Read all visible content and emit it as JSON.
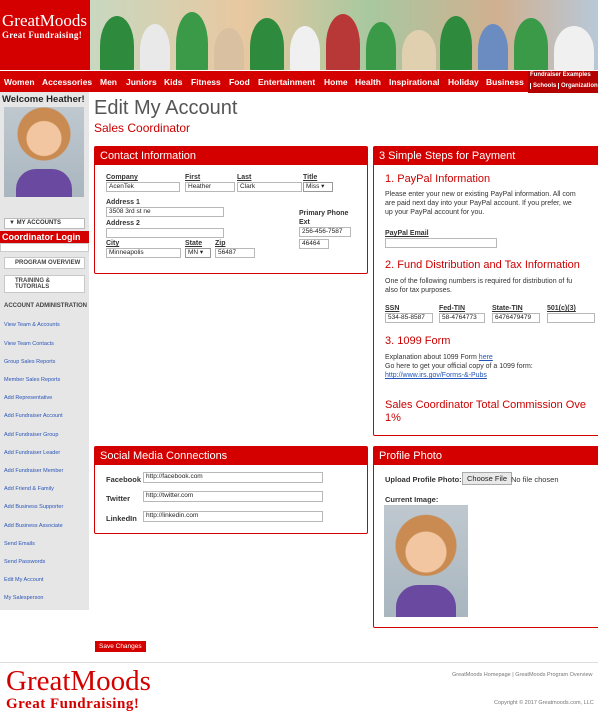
{
  "header": {
    "logo_line1": "GreatMoods",
    "logo_line2": "Great Fundraising!"
  },
  "nav": {
    "items": [
      "Women",
      "Accessories",
      "Men",
      "Juniors",
      "Kids",
      "Fitness",
      "Food",
      "Entertainment",
      "Home",
      "Health",
      "Inspirational",
      "Holiday",
      "Business"
    ],
    "fundraiser_examples": "Fundraiser Examples",
    "sub_items": [
      "Schools",
      "Organization"
    ]
  },
  "sidebar": {
    "welcome": "Welcome Heather!",
    "my_accounts": "▼ MY ACCOUNTS",
    "coordinator_login": "Coordinator Login",
    "program_overview": "PROGRAM OVERVIEW",
    "training": "TRAINING & TUTORIALS",
    "account_admin": "ACCOUNT ADMINISTRATION",
    "links": [
      "View Team & Accounts",
      "View Team Contacts",
      "Group Sales Reports",
      "Member Sales Reports",
      "Add Representative",
      "Add Fundraiser Account",
      "Add Fundraiser Group",
      "Add Fundraiser Leader",
      "Add Fundraiser Member",
      "Add Friend & Family",
      "Add Business Supporter",
      "Add Business Associate",
      "Send Emails",
      "Send Passwords",
      "Edit My Account",
      "My Salesperson"
    ]
  },
  "page": {
    "title": "Edit My Account",
    "subtitle": "Sales Coordinator"
  },
  "contact": {
    "heading": "Contact Information",
    "company_label": "Company",
    "company": "AcenTek",
    "first_label": "First",
    "first": "Heather",
    "last_label": "Last",
    "last": "Clark",
    "title_label": "Title",
    "title": "Miss",
    "address1_label": "Address 1",
    "address1": "3508 3rd st ne",
    "address2_label": "Address 2",
    "address2": "",
    "phone_label": "Primary Phone Ext",
    "phone": "256-456-7587",
    "ext": "46464",
    "city_label": "City",
    "city": "Minneapolis",
    "state_label": "State",
    "state": "MN",
    "zip_label": "Zip",
    "zip": "56487"
  },
  "payment": {
    "heading": "3 Simple Steps for Payment",
    "step1": "1. PayPal Information",
    "step1_text": [
      "Please enter your new or existing PayPal information. All com",
      "are paid next day into your PayPal account. If you prefer, we",
      "up your PayPal account for you."
    ],
    "paypal_label": "PayPal Email",
    "step2": "2. Fund Distribution and Tax Information",
    "step2_text": [
      "One of the following numbers is required for distribution of fu",
      "also for tax purposes."
    ],
    "ssn_label": "SSN",
    "ssn": "534-85-8587",
    "fedtin_label": "Fed-TIN",
    "fedtin": "58-4764773",
    "statetin_label": "State-TIN",
    "statetin": "6476479479",
    "c3_label": "501(c)(3)",
    "c3": "",
    "step3": "3. 1099 Form",
    "step3_text": "Explanation about 1099 Form",
    "here_link": "here",
    "step3_text2": "Go here to get your official copy of a 1099 form:",
    "irs_link": "http://www.irs.gov/Forms-&-Pubs",
    "commission_line1": "Sales Coordinator Total Commission Ove",
    "commission_line2": "1%"
  },
  "social": {
    "heading": "Social Media Connections",
    "facebook_label": "Facebook",
    "facebook": "http://facebook.com",
    "twitter_label": "Twitter",
    "twitter": "http://twitter.com",
    "linkedin_label": "LinkedIn",
    "linkedin": "http://linkedin.com"
  },
  "profile": {
    "heading": "Profile Photo",
    "upload_label": "Upload Profile Photo:",
    "choose_file": "Choose File",
    "no_file": "No file chosen",
    "current_label": "Current Image:"
  },
  "save_label": "Save Changes",
  "footer": {
    "logo_line1": "GreatMoods",
    "logo_line2": "Great Fundraising!",
    "link1": "GreatMoods Homepage",
    "link2": "GreatMoods Program Overview",
    "copyright": "Copyright © 2017 Greatmoods.com, LLC"
  }
}
